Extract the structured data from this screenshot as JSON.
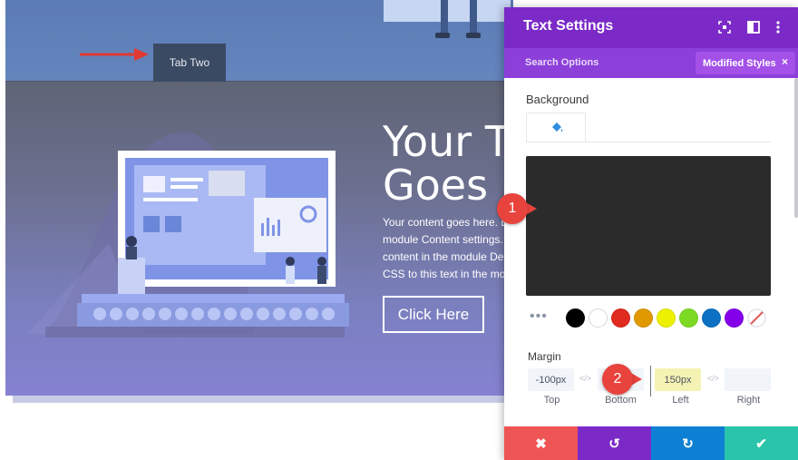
{
  "page": {
    "tab_label": "Tab Two",
    "hero_title_lines": [
      "Your T",
      "Goes H"
    ],
    "hero_body_lines": [
      "Your content goes here. E",
      "module Content settings.",
      "content in the module De",
      "CSS to this text in the mo"
    ],
    "cta_label": "Click Here"
  },
  "panel": {
    "title": "Text Settings",
    "header_icons": [
      "fullscreen-icon",
      "split-view-icon",
      "more-vertical-icon"
    ],
    "search_label": "Search Options",
    "modified_label": "Modified Styles",
    "modified_close": "×",
    "background_label": "Background",
    "background_tab_icon": "paint-bucket-icon",
    "preview_color": "#2b2b2b",
    "more_dots": "•••",
    "swatches": [
      {
        "name": "black",
        "color": "#000000"
      },
      {
        "name": "white",
        "color": "#ffffff"
      },
      {
        "name": "red",
        "color": "#e02b20"
      },
      {
        "name": "orange",
        "color": "#e09900"
      },
      {
        "name": "yellow",
        "color": "#edf000"
      },
      {
        "name": "green",
        "color": "#7cda24"
      },
      {
        "name": "blue",
        "color": "#0c71c3"
      },
      {
        "name": "purple",
        "color": "#8300e9"
      },
      {
        "name": "none",
        "color": "transparent"
      }
    ],
    "margin_label": "Margin",
    "margin": {
      "top": {
        "value": "-100px",
        "caption": "Top"
      },
      "bottom": {
        "value": "",
        "caption": "Bottom"
      },
      "left": {
        "value": "150px",
        "caption": "Left",
        "highlight": "#f5f3b3"
      },
      "right": {
        "value": "",
        "caption": "Right"
      }
    },
    "link_glyph": "⊘",
    "footer": {
      "cancel": "✖",
      "undo": "↺",
      "redo": "↻",
      "save": "✔"
    },
    "footer_colors": {
      "cancel": "#ef5555",
      "undo": "#7b2ac8",
      "redo": "#0e80d4",
      "save": "#29c4a9"
    }
  },
  "badges": {
    "step1": "1",
    "step2": "2"
  },
  "colors": {
    "accent_purple": "#7b2ac8",
    "badge_red": "#e8433d"
  }
}
